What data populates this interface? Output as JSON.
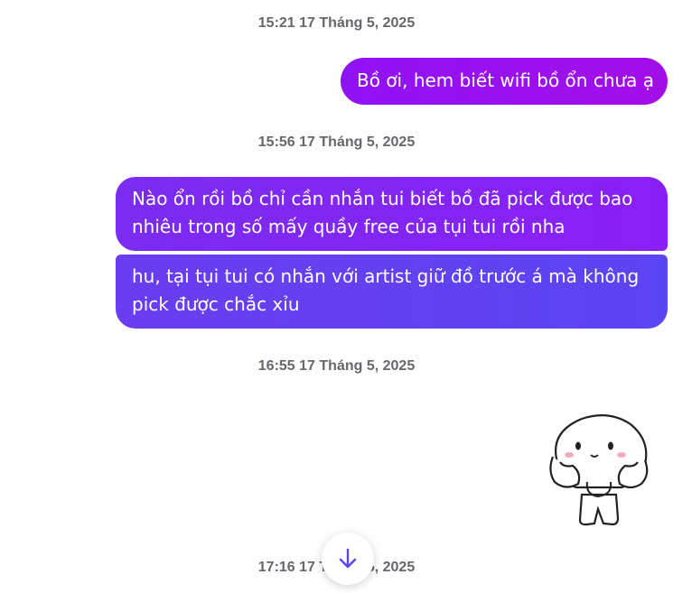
{
  "messages": [
    {
      "timestamp": "15:21 17 Tháng 5, 2025",
      "text": "Bồ ơi, hem biết wifi bồ ổn chưa ạ"
    },
    {
      "timestamp": "15:56 17 Tháng 5, 2025",
      "text": "Nào ổn rồi bồ chỉ cần nhắn tui biết bồ đã pick được bao nhiêu trong số mấy quầy free của tụi tui rồi nha"
    },
    {
      "text": "hu, tại tụi tui có nhắn với artist giữ đồ trước á mà không pick được chắc xỉu"
    },
    {
      "timestamp": "16:55 17 Tháng 5, 2025",
      "sticker": "cute-blob-sticker"
    },
    {
      "timestamp": "17:16 17 Tháng 5, 2025"
    }
  ],
  "scroll_button": {
    "icon": "arrow-down-icon"
  },
  "colors": {
    "bubble_start": "#9013f5",
    "bubble_end": "#5b45f2",
    "accent": "#5b45f2"
  }
}
